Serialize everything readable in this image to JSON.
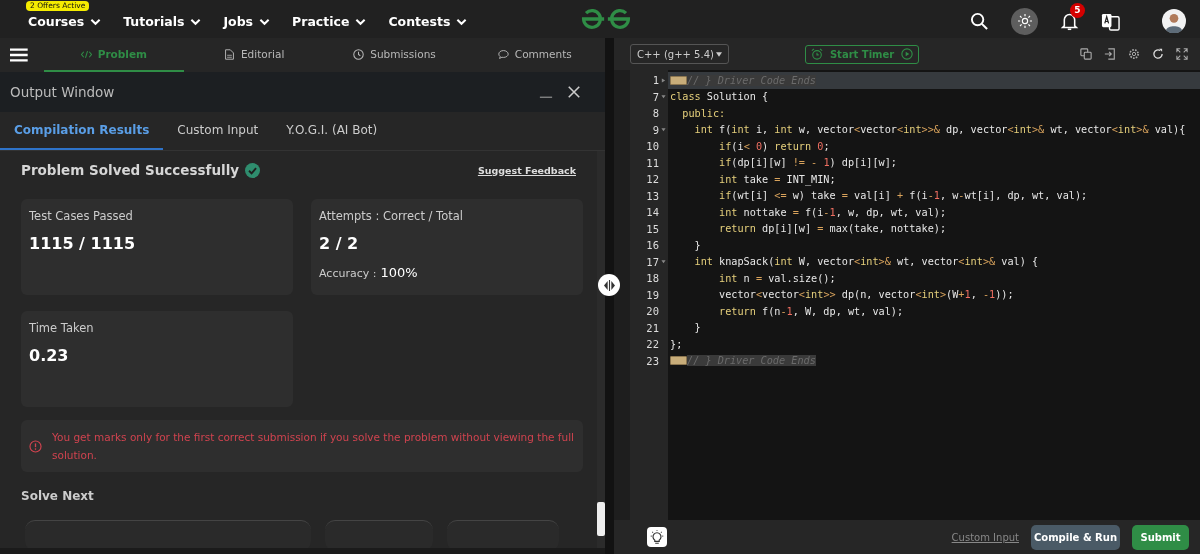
{
  "top_nav": {
    "badge": "2 Offers Active",
    "items": [
      {
        "label": "Courses"
      },
      {
        "label": "Tutorials"
      },
      {
        "label": "Jobs"
      },
      {
        "label": "Practice"
      },
      {
        "label": "Contests"
      }
    ],
    "notification_count": "5"
  },
  "problem_tabs": [
    {
      "label": "Problem",
      "selected": true
    },
    {
      "label": "Editorial",
      "selected": false
    },
    {
      "label": "Submissions",
      "selected": false
    },
    {
      "label": "Comments",
      "selected": false
    }
  ],
  "output_window": {
    "title": "Output Window",
    "tabs": [
      {
        "label": "Compilation Results",
        "selected": true
      },
      {
        "label": "Custom Input",
        "selected": false
      },
      {
        "label": "Y.O.G.I. (AI Bot)",
        "selected": false
      }
    ],
    "status": "Problem Solved Successfully",
    "feedback_link": "Suggest Feedback",
    "stats": [
      {
        "label": "Test Cases Passed",
        "value": "1115 / 1115"
      },
      {
        "label": "Attempts : Correct / Total",
        "value": "2 / 2",
        "extra_label": "Accuracy :",
        "extra_value": "100%"
      },
      {
        "label": "Time Taken",
        "value": "0.23"
      }
    ],
    "notice": "You get marks only for the first correct submission if you solve the problem without viewing the full solution.",
    "solve_next": "Solve Next"
  },
  "editor": {
    "language": "C++ (g++ 5.4)",
    "timer_button": "Start Timer",
    "lines": [
      {
        "number": "1",
        "foldable": true,
        "expanded": false,
        "active": true,
        "folded": true,
        "tokens": [
          {
            "text": "// } Driver Code Ends",
            "kind": "comment"
          }
        ]
      },
      {
        "number": "7",
        "foldable": true,
        "expanded": true,
        "active": false,
        "folded": false,
        "tokens": [
          {
            "text": "class",
            "kind": "keyword"
          },
          {
            "text": " Solution {",
            "kind": "plain"
          }
        ]
      },
      {
        "number": "8",
        "foldable": false,
        "active": false,
        "folded": false,
        "tokens": [
          {
            "text": "  public:",
            "kind": "keyword"
          }
        ]
      },
      {
        "number": "9",
        "foldable": true,
        "expanded": true,
        "active": false,
        "folded": false,
        "tokens": [
          {
            "text": "    int",
            "kind": "keyword"
          },
          {
            "text": " f(",
            "kind": "plain"
          },
          {
            "text": "int",
            "kind": "keyword"
          },
          {
            "text": " i, ",
            "kind": "plain"
          },
          {
            "text": "int",
            "kind": "keyword"
          },
          {
            "text": " w, vector",
            "kind": "plain"
          },
          {
            "text": "<",
            "kind": "op"
          },
          {
            "text": "vector",
            "kind": "plain"
          },
          {
            "text": "<",
            "kind": "op"
          },
          {
            "text": "int",
            "kind": "keyword"
          },
          {
            "text": ">>&",
            "kind": "op"
          },
          {
            "text": " dp, vector",
            "kind": "plain"
          },
          {
            "text": "<",
            "kind": "op"
          },
          {
            "text": "int",
            "kind": "keyword"
          },
          {
            "text": ">&",
            "kind": "op"
          },
          {
            "text": " wt, vector",
            "kind": "plain"
          },
          {
            "text": "<",
            "kind": "op"
          },
          {
            "text": "int",
            "kind": "keyword"
          },
          {
            "text": ">&",
            "kind": "op"
          },
          {
            "text": " val){",
            "kind": "plain"
          }
        ]
      },
      {
        "number": "10",
        "foldable": false,
        "active": false,
        "folded": false,
        "tokens": [
          {
            "text": "        if",
            "kind": "keyword"
          },
          {
            "text": "(i",
            "kind": "plain"
          },
          {
            "text": "<",
            "kind": "op"
          },
          {
            "text": " 0",
            "kind": "number"
          },
          {
            "text": ") ",
            "kind": "plain"
          },
          {
            "text": "return",
            "kind": "keyword"
          },
          {
            "text": " 0",
            "kind": "number"
          },
          {
            "text": ";",
            "kind": "plain"
          }
        ]
      },
      {
        "number": "11",
        "foldable": false,
        "active": false,
        "folded": false,
        "tokens": [
          {
            "text": "        if",
            "kind": "keyword"
          },
          {
            "text": "(dp[i][w] ",
            "kind": "plain"
          },
          {
            "text": "!=",
            "kind": "op"
          },
          {
            "text": " -",
            "kind": "op"
          },
          {
            "text": " 1",
            "kind": "number"
          },
          {
            "text": ") dp[i][w];",
            "kind": "plain"
          }
        ]
      },
      {
        "number": "12",
        "foldable": false,
        "active": false,
        "folded": false,
        "tokens": [
          {
            "text": "        int",
            "kind": "keyword"
          },
          {
            "text": " take ",
            "kind": "plain"
          },
          {
            "text": "=",
            "kind": "op"
          },
          {
            "text": " INT_MIN;",
            "kind": "plain"
          }
        ]
      },
      {
        "number": "13",
        "foldable": false,
        "active": false,
        "folded": false,
        "tokens": [
          {
            "text": "        if",
            "kind": "keyword"
          },
          {
            "text": "(wt[i] ",
            "kind": "plain"
          },
          {
            "text": "<=",
            "kind": "op"
          },
          {
            "text": " w) take ",
            "kind": "plain"
          },
          {
            "text": "=",
            "kind": "op"
          },
          {
            "text": " val[i] ",
            "kind": "plain"
          },
          {
            "text": "+",
            "kind": "op"
          },
          {
            "text": " f(i",
            "kind": "plain"
          },
          {
            "text": "-",
            "kind": "op"
          },
          {
            "text": "1",
            "kind": "number"
          },
          {
            "text": ", w",
            "kind": "plain"
          },
          {
            "text": "-",
            "kind": "op"
          },
          {
            "text": "wt[i], dp, wt, val);",
            "kind": "plain"
          }
        ]
      },
      {
        "number": "14",
        "foldable": false,
        "active": false,
        "folded": false,
        "tokens": [
          {
            "text": "        int",
            "kind": "keyword"
          },
          {
            "text": " nottake ",
            "kind": "plain"
          },
          {
            "text": "=",
            "kind": "op"
          },
          {
            "text": " f(i",
            "kind": "plain"
          },
          {
            "text": "-",
            "kind": "op"
          },
          {
            "text": "1",
            "kind": "number"
          },
          {
            "text": ", w, dp, wt, val);",
            "kind": "plain"
          }
        ]
      },
      {
        "number": "15",
        "foldable": false,
        "active": false,
        "folded": false,
        "tokens": [
          {
            "text": "        return",
            "kind": "keyword"
          },
          {
            "text": " dp[i][w] ",
            "kind": "plain"
          },
          {
            "text": "=",
            "kind": "op"
          },
          {
            "text": " max(take, nottake);",
            "kind": "plain"
          }
        ]
      },
      {
        "number": "16",
        "foldable": false,
        "active": false,
        "folded": false,
        "tokens": [
          {
            "text": "    }",
            "kind": "plain"
          }
        ]
      },
      {
        "number": "17",
        "foldable": true,
        "expanded": true,
        "active": false,
        "folded": false,
        "tokens": [
          {
            "text": "    int",
            "kind": "keyword"
          },
          {
            "text": " knapSack(",
            "kind": "plain"
          },
          {
            "text": "int",
            "kind": "keyword"
          },
          {
            "text": " W, vector",
            "kind": "plain"
          },
          {
            "text": "<",
            "kind": "op"
          },
          {
            "text": "int",
            "kind": "keyword"
          },
          {
            "text": ">&",
            "kind": "op"
          },
          {
            "text": " wt, vector",
            "kind": "plain"
          },
          {
            "text": "<",
            "kind": "op"
          },
          {
            "text": "int",
            "kind": "keyword"
          },
          {
            "text": ">&",
            "kind": "op"
          },
          {
            "text": " val) {",
            "kind": "plain"
          }
        ]
      },
      {
        "number": "18",
        "foldable": false,
        "active": false,
        "folded": false,
        "tokens": [
          {
            "text": "        int",
            "kind": "keyword"
          },
          {
            "text": " n ",
            "kind": "plain"
          },
          {
            "text": "=",
            "kind": "op"
          },
          {
            "text": " val.size();",
            "kind": "plain"
          }
        ]
      },
      {
        "number": "19",
        "foldable": false,
        "active": false,
        "folded": false,
        "tokens": [
          {
            "text": "        vector",
            "kind": "plain"
          },
          {
            "text": "<",
            "kind": "op"
          },
          {
            "text": "vector",
            "kind": "plain"
          },
          {
            "text": "<",
            "kind": "op"
          },
          {
            "text": "int",
            "kind": "keyword"
          },
          {
            "text": ">>",
            "kind": "op"
          },
          {
            "text": " dp(n, vector",
            "kind": "plain"
          },
          {
            "text": "<",
            "kind": "op"
          },
          {
            "text": "int",
            "kind": "keyword"
          },
          {
            "text": ">",
            "kind": "op"
          },
          {
            "text": "(W",
            "kind": "plain"
          },
          {
            "text": "+",
            "kind": "op"
          },
          {
            "text": "1",
            "kind": "number"
          },
          {
            "text": ", ",
            "kind": "plain"
          },
          {
            "text": "-",
            "kind": "op"
          },
          {
            "text": "1",
            "kind": "number"
          },
          {
            "text": "));",
            "kind": "plain"
          }
        ]
      },
      {
        "number": "20",
        "foldable": false,
        "active": false,
        "folded": false,
        "tokens": [
          {
            "text": "        return",
            "kind": "keyword"
          },
          {
            "text": " f(n",
            "kind": "plain"
          },
          {
            "text": "-",
            "kind": "op"
          },
          {
            "text": "1",
            "kind": "number"
          },
          {
            "text": ", W, dp, wt, val);",
            "kind": "plain"
          }
        ]
      },
      {
        "number": "21",
        "foldable": false,
        "active": false,
        "folded": false,
        "tokens": [
          {
            "text": "    }",
            "kind": "plain"
          }
        ]
      },
      {
        "number": "22",
        "foldable": false,
        "active": false,
        "folded": false,
        "tokens": [
          {
            "text": "};",
            "kind": "plain"
          }
        ]
      },
      {
        "number": "23",
        "foldable": false,
        "active": false,
        "folded": true,
        "tokens": [
          {
            "text": "// } Driver Code Ends",
            "kind": "comment"
          }
        ]
      }
    ]
  },
  "footer": {
    "custom_input": "Custom Input",
    "buttons": [
      {
        "label": "Compile & Run",
        "kind": "secondary"
      },
      {
        "label": "Submit",
        "kind": "primary"
      }
    ]
  }
}
